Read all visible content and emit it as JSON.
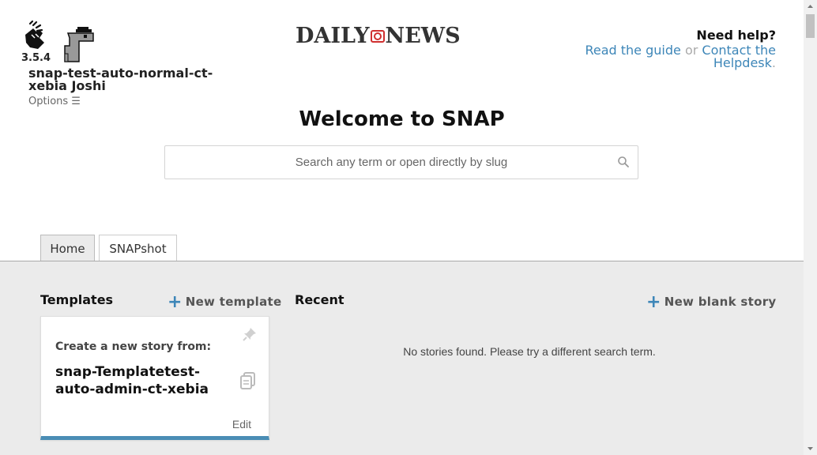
{
  "app": {
    "version": "3.5.4",
    "username": "snap-test-auto-normal-ct-xebia Joshi",
    "options_label": "Options ☰"
  },
  "brand": {
    "left": "DAILY",
    "right": "NEWS"
  },
  "help": {
    "title": "Need help?",
    "guide_link": "Read the guide",
    "or": "or",
    "helpdesk_link": "Contact the Helpdesk",
    "period": "."
  },
  "welcome": "Welcome to SNAP",
  "search": {
    "placeholder": "Search any term or open directly by slug",
    "icon": "search-icon"
  },
  "tabs": [
    {
      "label": "Home",
      "active": true
    },
    {
      "label": "SNAPshot",
      "active": false
    }
  ],
  "templates": {
    "heading": "Templates",
    "new_label": "New template",
    "card": {
      "subtitle": "Create a new story from:",
      "title": "snap-Templatetest-auto-admin-ct-xebia",
      "edit_label": "Edit"
    }
  },
  "recent": {
    "heading": "Recent",
    "new_label": "New blank story",
    "empty_message": "No stories found. Please try a different search term."
  },
  "colors": {
    "accent": "#3d86b8",
    "card_border": "#4a8db5",
    "main_bg": "#ebebeb"
  }
}
